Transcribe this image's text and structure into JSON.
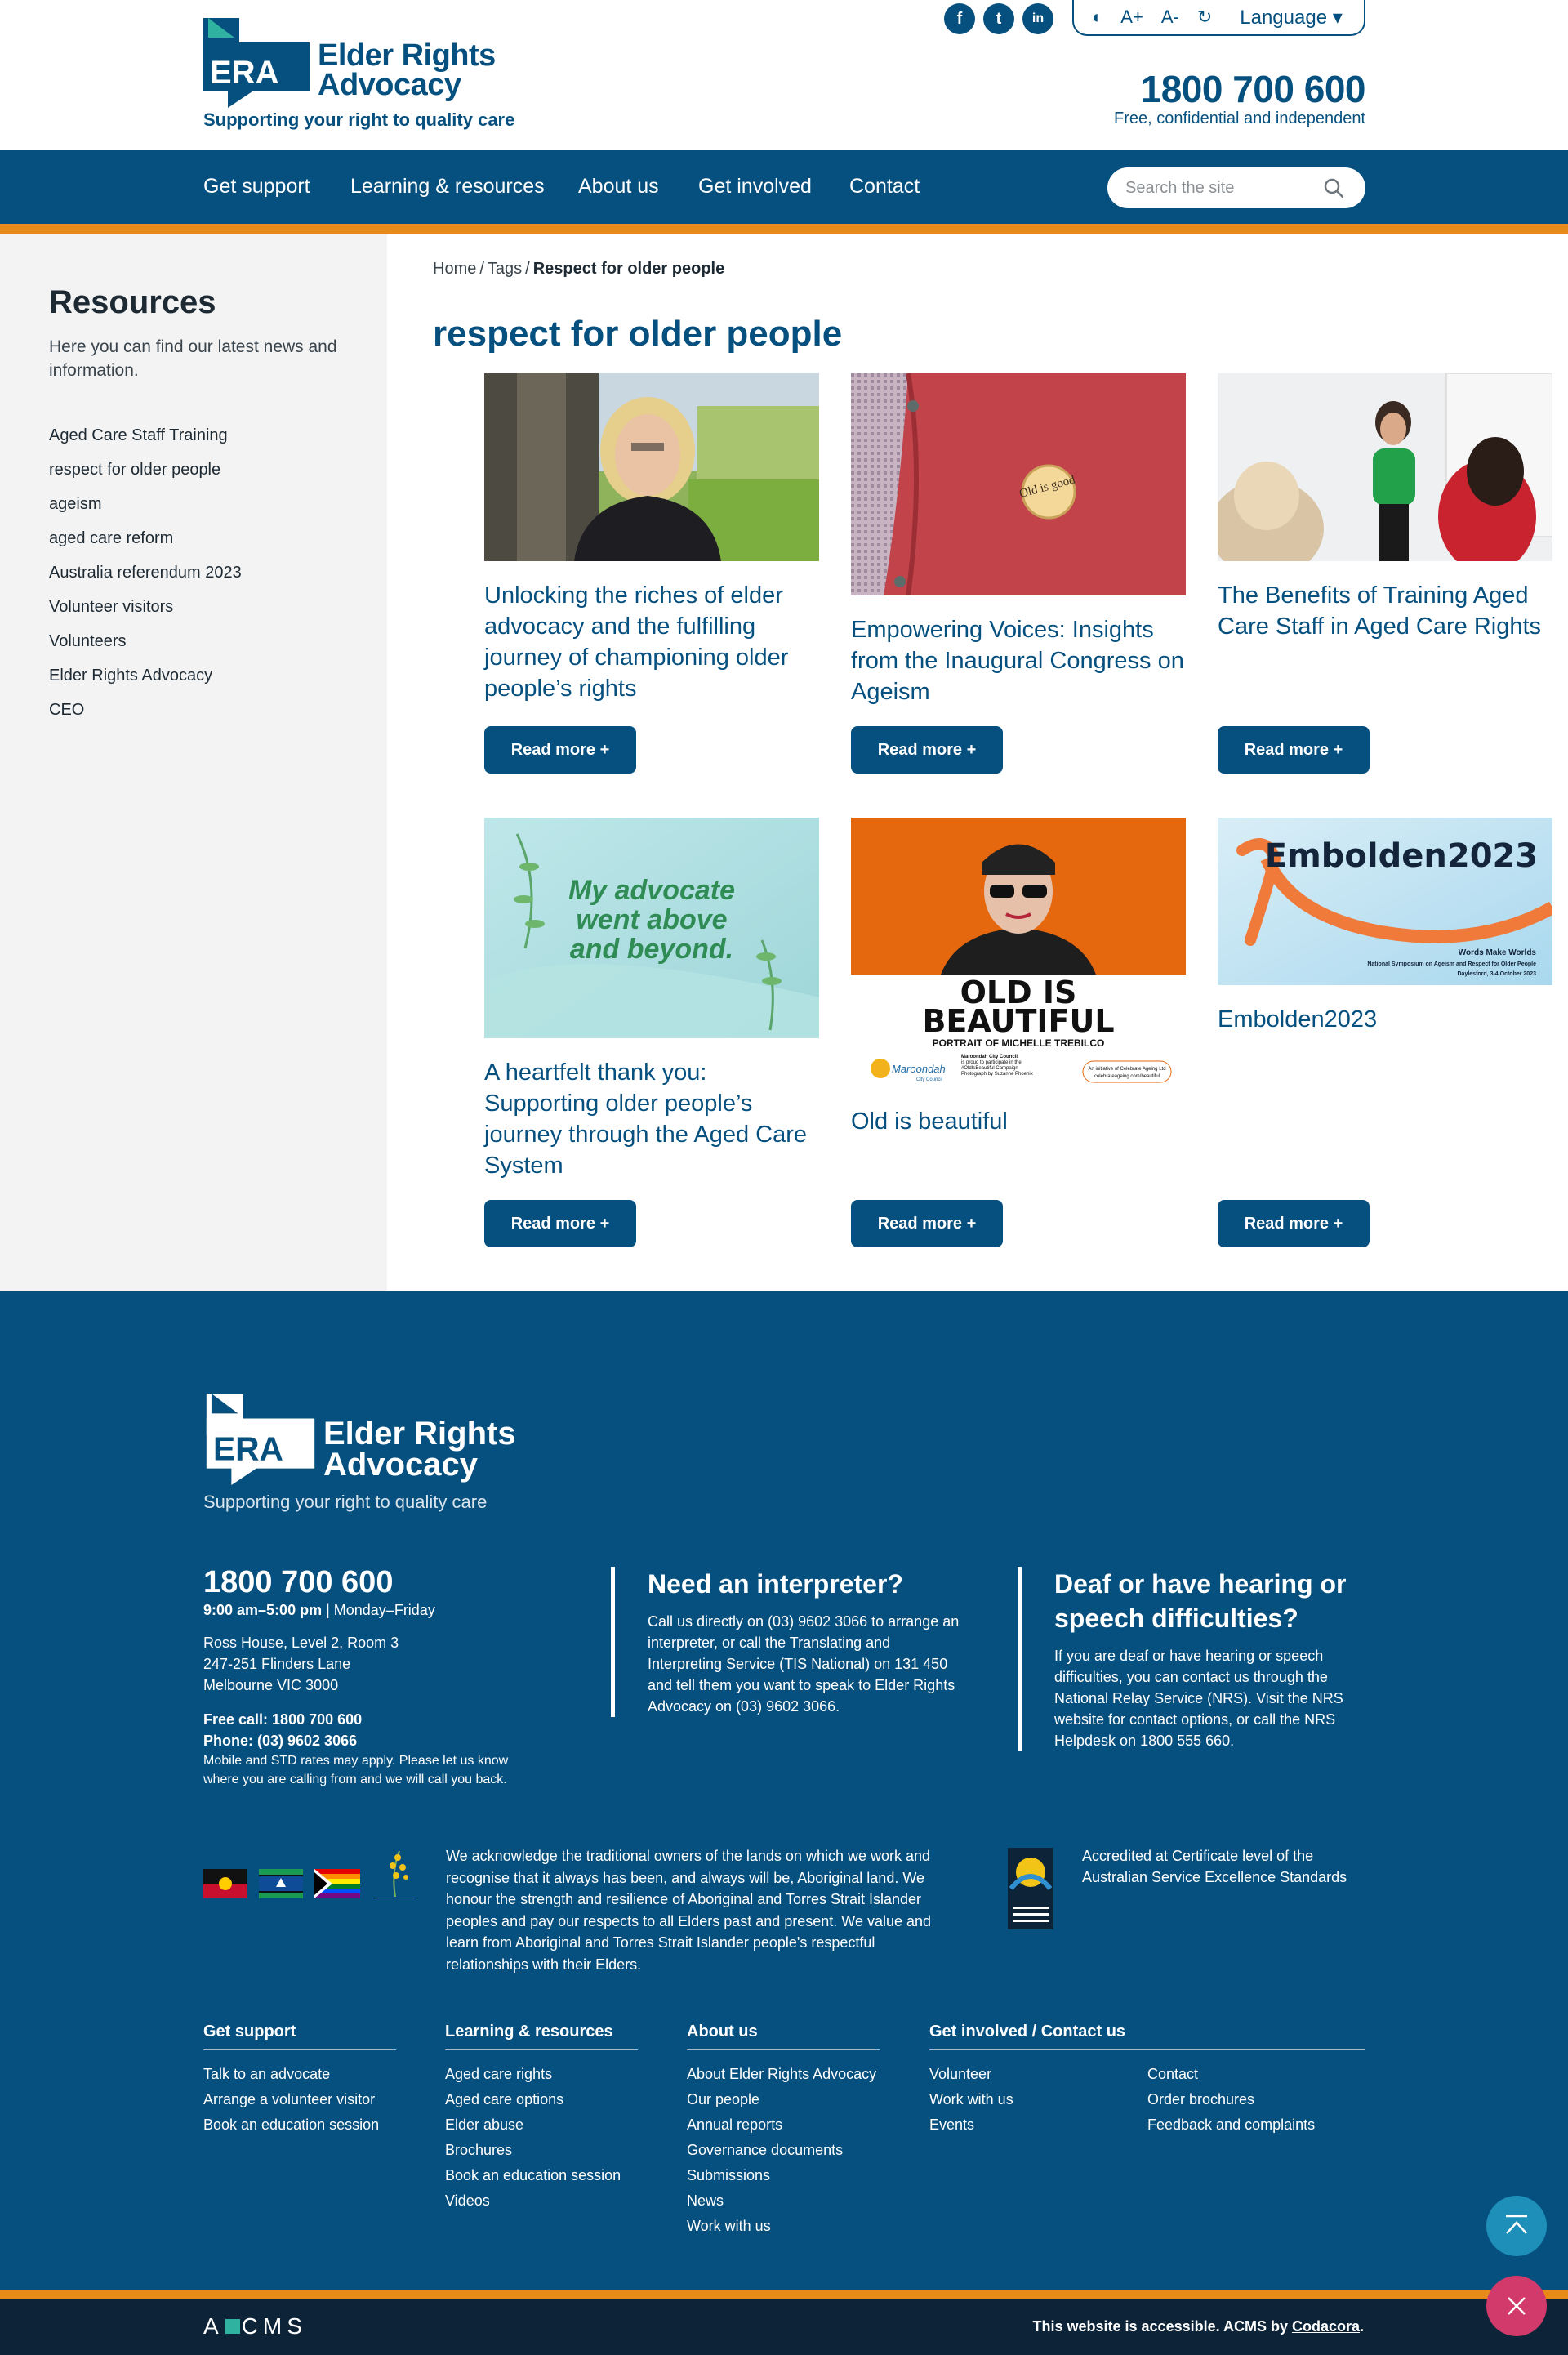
{
  "header": {
    "logo_abbr": "ERA",
    "logo_name_line1": "Elder Rights",
    "logo_name_line2": "Advocacy",
    "logo_tagline": "Supporting your right to quality care",
    "social": [
      "f",
      "t",
      "in"
    ],
    "tools": {
      "contrast": "◐",
      "increase": "A+",
      "decrease": "A-",
      "reset": "↻",
      "language": "Language ▾"
    },
    "phone": "1800 700 600",
    "phone_sub": "Free, confidential and independent"
  },
  "nav": {
    "items": [
      "Get support",
      "Learning & resources",
      "About us",
      "Get involved",
      "Contact"
    ],
    "search_placeholder": "Search the site"
  },
  "sidebar": {
    "title": "Resources",
    "description": "Here you can find our latest news and information.",
    "items": [
      "Aged Care Staff Training",
      "respect for older people",
      "ageism",
      "aged care reform",
      "Australia referendum 2023",
      "Volunteer visitors",
      "Volunteers",
      "Elder Rights Advocacy",
      "CEO"
    ]
  },
  "breadcrumb": {
    "home": "Home",
    "tags": "Tags",
    "current": "Respect for older people",
    "sep": "/"
  },
  "page_title": "respect for older people",
  "cards": [
    {
      "title": "Unlocking the riches of elder advocacy and the fulfilling journey of championing older people’s rights",
      "button": "Read more +"
    },
    {
      "title": "Empowering Voices: Insights from the Inaugural Congress on Ageism",
      "button": "Read more +",
      "badge_text": "Old is good"
    },
    {
      "title": "The Benefits of Training Aged Care Staff in Aged Care Rights",
      "button": "Read more +"
    },
    {
      "title": "A heartfelt thank you: Supporting older people’s journey through the Aged Care System",
      "button": "Read more +",
      "image_text": [
        "My advocate",
        "went above",
        "and beyond."
      ]
    },
    {
      "title": "Old is beautiful",
      "button": "Read more +",
      "image_text": [
        "OLD IS",
        "BEAUTIFUL",
        "PORTRAIT OF MICHELLE TREBILCO",
        "Maroondah City Council",
        "is proud to participate in the",
        "#OldIsBeautiful Campaign",
        "Photograph by Suzanne Phoenix",
        "An initiative of Celebrate Ageing Ltd",
        "celebrateageing.com/beautiful",
        "Maroondah",
        "City Council"
      ]
    },
    {
      "title": "Embolden2023",
      "button": "Read more +",
      "image_text": [
        "Embolden2023",
        "Words Make Worlds",
        "National Symposium on Ageism and Respect for Older People",
        "Daylesford, 3-4 October 2023"
      ]
    }
  ],
  "footer": {
    "logo_abbr": "ERA",
    "logo_name_line1": "Elder Rights",
    "logo_name_line2": "Advocacy",
    "logo_tagline": "Supporting your right to quality care",
    "phone": "1800 700 600",
    "hours_bold": "9:00 am–5:00 pm",
    "hours_rest": " | Monday–Friday",
    "address": [
      "Ross House, Level 2, Room 3",
      "247-251 Flinders Lane",
      "Melbourne VIC 3000"
    ],
    "free_call": "Free call: 1800 700 600",
    "phone_line": "Phone: (03) 9602 3066",
    "note": "Mobile and STD rates may apply. Please let us know where you are calling from and we will call you back.",
    "interpreter_title": "Need an interpreter?",
    "interpreter_text": "Call us directly on (03) 9602 3066 to arrange an interpreter, or call the Translating and Interpreting Service (TIS National) on 131 450 and tell them you want to speak to Elder Rights Advocacy on (03) 9602 3066.",
    "deaf_title": "Deaf or have hearing or speech difficulties?",
    "deaf_text": "If you are deaf or have hearing or speech difficulties, you can contact us through the National Relay Service (NRS). Visit the NRS website for contact options, or call the NRS Helpdesk on 1800 555 660.",
    "acknowledgement": "We acknowledge the traditional owners of the lands on which we work and recognise that it always has been, and always will be, Aboriginal land. We honour the strength and resilience of Aboriginal and Torres Strait Islander peoples and pay our respects to all Elders past and present. We value and learn from Aboriginal and Torres Strait Islander people's respectful relationships with their Elders.",
    "accreditation": "Accredited at Certificate level of the Australian Service Excellence Standards",
    "menus": {
      "get_support": {
        "title": "Get support",
        "items": [
          "Talk to an advocate",
          "Arrange a volunteer visitor",
          "Book an education session"
        ]
      },
      "learning": {
        "title": "Learning & resources",
        "items": [
          "Aged care rights",
          "Aged care options",
          "Elder abuse",
          "Brochures",
          "Book an education session",
          "Videos"
        ]
      },
      "about": {
        "title": "About us",
        "items": [
          "About Elder Rights Advocacy",
          "Our people",
          "Annual reports",
          "Governance documents",
          "Submissions",
          "News",
          "Work with us"
        ]
      },
      "involved": {
        "title": "Get involved / Contact us",
        "items_left": [
          "Volunteer",
          "Work with us",
          "Events"
        ],
        "items_right": [
          "Contact",
          "Order brochures",
          "Feedback and complaints"
        ]
      }
    }
  },
  "bottom": {
    "acms_left": "A",
    "acms_right": "CMS",
    "a11y_text": "This website is accessible. ACMS by ",
    "a11y_link": "Codacora",
    "a11y_end": "."
  },
  "colors": {
    "primary": "#06507f",
    "accent": "#e88a1a",
    "footer_bottom": "#0d2438",
    "to_top": "#1e8fb8",
    "close": "#d23a6b"
  }
}
